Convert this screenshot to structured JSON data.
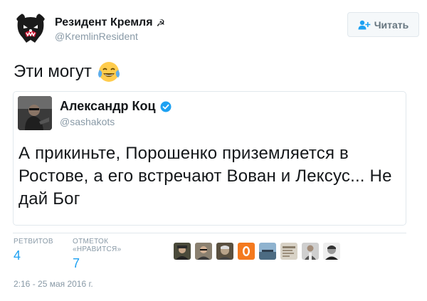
{
  "author": {
    "name": "Резидент Кремля",
    "handle": "@KremlinResident",
    "name_symbol": "☭"
  },
  "follow": {
    "label": "Читать",
    "icon": "follow-user-icon"
  },
  "tweet": {
    "text": "Эти могут",
    "emoji": "face-with-tears-of-joy-icon"
  },
  "quoted": {
    "name": "Александр Коц",
    "handle": "@sashakots",
    "verified": true,
    "text": "А прикиньте, Порошенко приземляется в Ростове, а его встречают Вован и Лексус... Не дай Бог"
  },
  "stats": {
    "retweets_label": "РЕТВИТОВ",
    "retweets": "4",
    "likes_label": "ОТМЕТОК «НРАВИТСЯ»",
    "likes": "7"
  },
  "likers": [
    {
      "name": "liker-avatar-1"
    },
    {
      "name": "liker-avatar-2"
    },
    {
      "name": "liker-avatar-3"
    },
    {
      "name": "liker-avatar-4"
    },
    {
      "name": "liker-avatar-5"
    },
    {
      "name": "liker-avatar-6"
    },
    {
      "name": "liker-avatar-7"
    }
  ],
  "timestamp": "2:16 - 25 мая 2016 г.",
  "colors": {
    "accent": "#1da1f2",
    "muted": "#8899a6",
    "border": "#e1e8ed"
  }
}
